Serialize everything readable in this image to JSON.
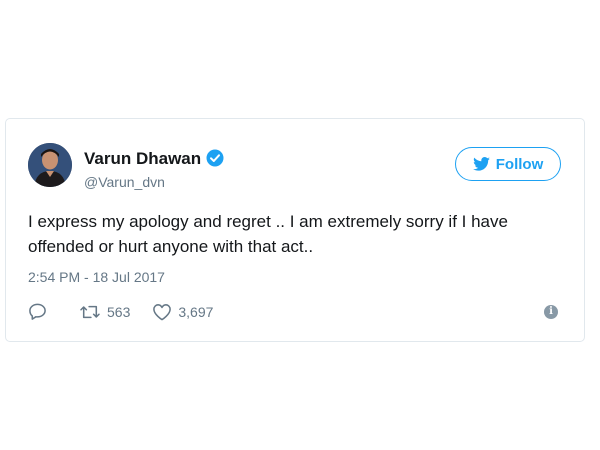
{
  "tweet": {
    "display_name": "Varun Dhawan",
    "handle": "@Varun_dvn",
    "follow_label": "Follow",
    "text": "I express my apology and regret .. I am extremely sorry if I have offended or hurt anyone with that act..",
    "timestamp": "2:54 PM - 18 Jul 2017",
    "retweets": "563",
    "likes": "3,697",
    "info_glyph": "i"
  },
  "icons": {
    "avatar": "profile-photo",
    "verified": "verified-badge-icon",
    "follow": "twitter-bird-icon",
    "reply": "reply-icon",
    "retweet": "retweet-icon",
    "like": "heart-icon",
    "info": "info-icon"
  },
  "colors": {
    "accent": "#1da1f2",
    "text": "#14171a",
    "muted": "#657786",
    "border": "#e1e8ed"
  }
}
